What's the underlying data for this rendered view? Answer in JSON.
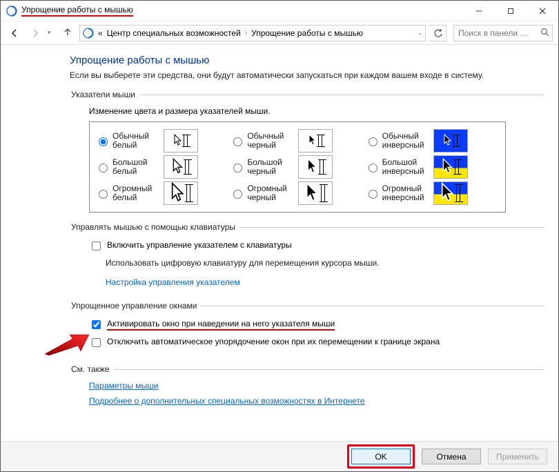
{
  "window": {
    "title": "Упрощение работы с мышью"
  },
  "breadcrumb": {
    "item1": "Центр специальных возможностей",
    "item2": "Упрощение работы с мышью"
  },
  "search": {
    "placeholder": "Поиск в панели …"
  },
  "page": {
    "heading": "Упрощение работы с мышью",
    "subtitle": "Если вы выберете эти средства, они будут автоматически запускаться при каждом вашем входе в систему."
  },
  "groups": {
    "pointers": {
      "legend": "Указатели мыши",
      "desc": "Изменение цвета и размера указателей мыши.",
      "opts": {
        "r0c0": "Обычный белый",
        "r0c1": "Обычный черный",
        "r0c2": "Обычный инверсный",
        "r1c0": "Большой белый",
        "r1c1": "Большой черный",
        "r1c2": "Большой инверсный",
        "r2c0": "Огромный белый",
        "r2c1": "Огромный черный",
        "r2c2": "Огромный инверсный"
      }
    },
    "keyboard": {
      "legend": "Управлять мышью с помощью клавиатуры",
      "chk1": "Включить управление указателем с клавиатуры",
      "help": "Использовать цифровую клавиатуру для перемещения курсора мыши.",
      "link": "Настройка управления указателем"
    },
    "windows": {
      "legend": "Упрощенное управление окнами",
      "chk1": "Активировать окно при наведении на него указателя мыши",
      "chk2": "Отключить автоматическое упорядочение окон при их перемещении к границе экрана"
    },
    "seealso": {
      "legend": "См. также",
      "link1": "Параметры мыши",
      "link2": "Подробнее о дополнительных специальных возможностях в Интернете"
    }
  },
  "footer": {
    "ok": "OK",
    "cancel": "Отмена",
    "apply": "Применить"
  }
}
